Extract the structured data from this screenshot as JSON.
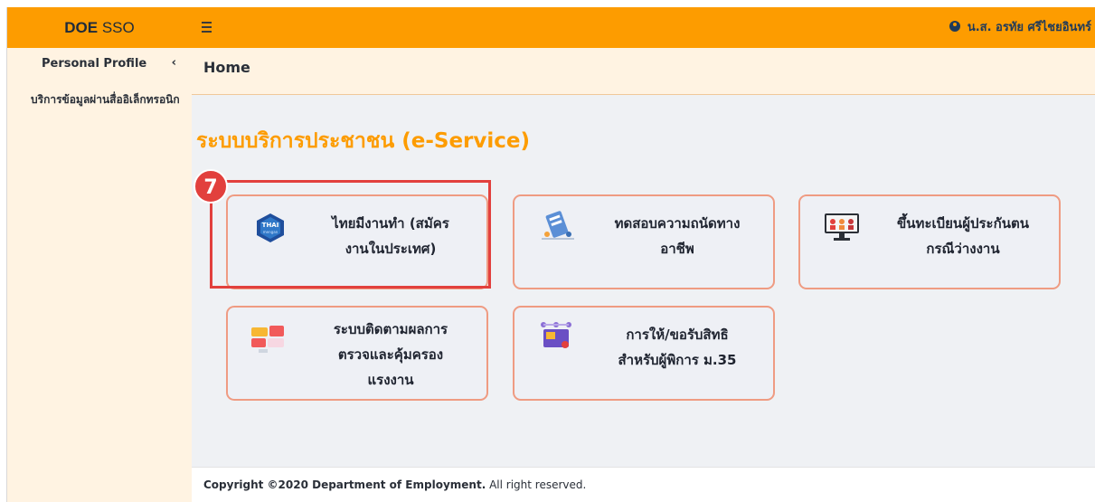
{
  "topbar": {
    "brand_bold": "DOE",
    "brand_light": "SSO",
    "user_name": "น.ส. อรทัย ศรีไชยอินทร์"
  },
  "sidebar": {
    "items": [
      {
        "label": "Personal Profile"
      },
      {
        "label": "บริการข้อมูลผ่านสื่ออิเล็กทรอนิก"
      }
    ]
  },
  "header": {
    "title": "Home"
  },
  "main": {
    "section_title": "ระบบบริการประชาชน (e-Service)",
    "step_badge": "7",
    "cards": [
      {
        "line1": "ไทยมีงานทำ (สมัคร",
        "line2": "งานในประเทศ)",
        "icon": "thai-mengan-logo-icon"
      },
      {
        "line1": "ทดสอบความถนัดทาง",
        "line2": "อาชีพ",
        "icon": "aptitude-test-icon"
      },
      {
        "line1": "ขึ้นทะเบียนผู้ประกันตน",
        "line2": "กรณีว่างงาน",
        "icon": "unemployment-register-icon"
      },
      {
        "line1": "ระบบติดตามผลการ",
        "line2": "ตรวจและคุ้มครอง",
        "line3": "แรงงาน",
        "icon": "labor-inspection-icon"
      },
      {
        "line1": "การให้/ขอรับสิทธิ",
        "line2": "สำหรับผู้พิการ ม.35",
        "icon": "disability-rights-icon"
      }
    ]
  },
  "footer": {
    "copyright_bold": "Copyright ©2020 Department of Employment.",
    "copyright_rest": " All right reserved."
  },
  "colors": {
    "accent_orange": "#fd9c00",
    "card_border": "#ef9b82",
    "highlight_red": "#e2403d"
  }
}
